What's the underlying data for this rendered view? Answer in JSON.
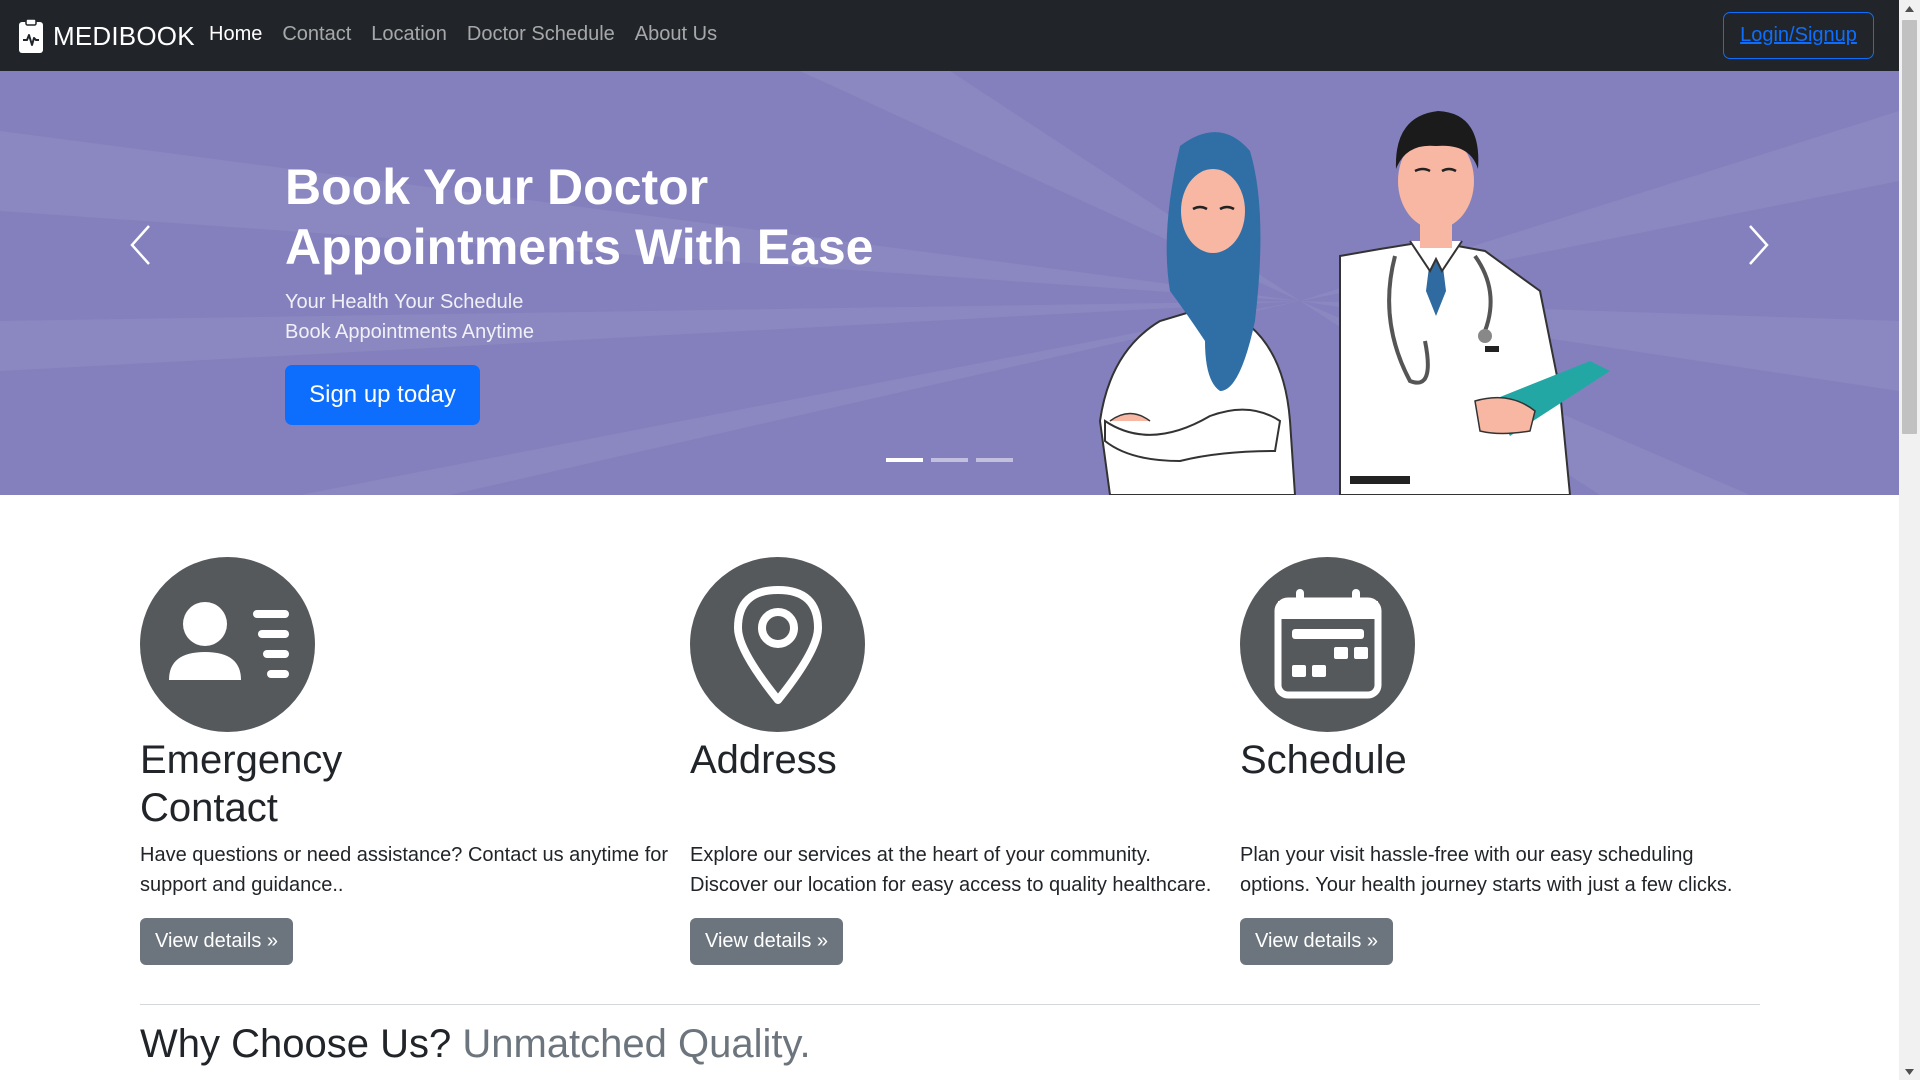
{
  "navbar": {
    "brand": "MEDIBOOK",
    "brand_icon": "clipboard-heartbeat-icon",
    "links": [
      "Home",
      "Contact",
      "Location",
      "Doctor Schedule",
      "About Us"
    ],
    "active_link": "Home",
    "login_label": "Login/Signup",
    "bg_color": "#212529",
    "accent_color": "#0d6efd"
  },
  "hero": {
    "title_line1": "Book Your Doctor",
    "title_line2": "Appointments With Ease",
    "subtitle_line1": "Your Health Your Schedule",
    "subtitle_line2": "Book Appointments Anytime",
    "cta_label": "Sign up today",
    "slide_count": 3,
    "active_slide": 1,
    "bg_color": "#8480bd",
    "prev_icon": "chevron-left-icon",
    "next_icon": "chevron-right-icon"
  },
  "features": [
    {
      "icon": "person-card-icon",
      "title_line1": "Emergency",
      "title_line2": "Contact",
      "text_line1": "Have questions or need assistance? Contact us anytime for",
      "text_line2": "support and guidance..",
      "button": "View details »"
    },
    {
      "icon": "map-pin-icon",
      "title_line1": "Address",
      "title_line2": "",
      "text_line1": "Explore our services at the heart of your community.",
      "text_line2": "Discover our location for easy access to quality healthcare.",
      "button": "View details »"
    },
    {
      "icon": "calendar-icon",
      "title_line1": "Schedule",
      "title_line2": "",
      "text_line1": "Plan your visit hassle-free with our easy scheduling",
      "text_line2": "options. Your health journey starts with just a few clicks.",
      "button": "View details »"
    }
  ],
  "section": {
    "heading": "Why Choose Us?",
    "heading_muted": "Unmatched Quality."
  }
}
